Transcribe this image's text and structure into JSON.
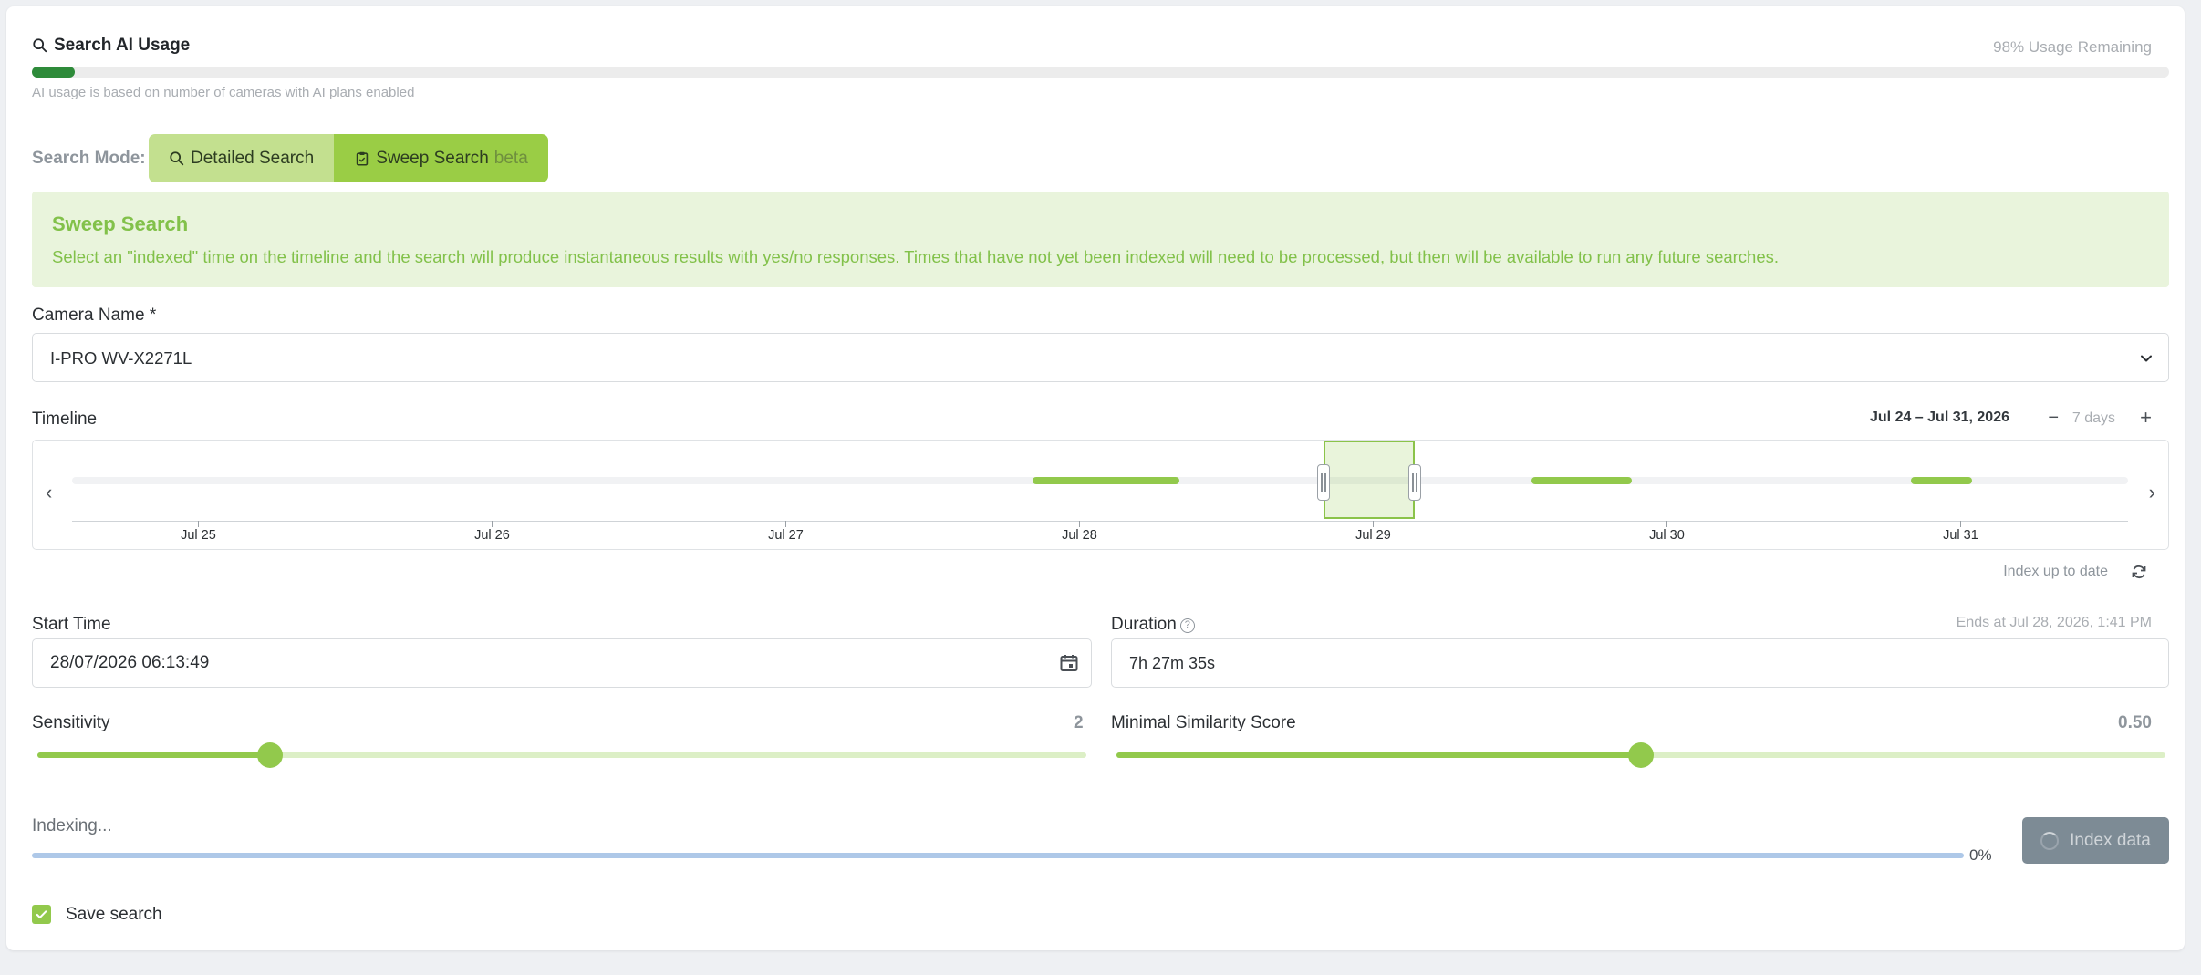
{
  "usage": {
    "title": "Search AI Usage",
    "remaining": "98% Usage Remaining",
    "used_fraction": 0.02,
    "note": "AI usage is based on number of cameras with AI plans enabled"
  },
  "search_mode": {
    "label": "Search Mode:",
    "detailed_label": "Detailed Search",
    "sweep_label": "Sweep Search",
    "sweep_badge": "beta",
    "active": "sweep"
  },
  "banner": {
    "title": "Sweep Search",
    "text": "Select an \"indexed\" time on the timeline and the search will produce instantaneous results with yes/no responses. Times that have not yet been indexed will need to be processed, but then will be available to run any future searches."
  },
  "camera": {
    "label": "Camera Name *",
    "value": "I-PRO WV-X2271L"
  },
  "timeline": {
    "label": "Timeline",
    "range": "Jul 24 – Jul 31, 2026",
    "zoom_minus": "−",
    "zoom_label": "7 days",
    "zoom_plus": "+",
    "prev": "‹",
    "next": "›",
    "ticks": [
      "Jul 25",
      "Jul 26",
      "Jul 27",
      "Jul 28",
      "Jul 29",
      "Jul 30",
      "Jul 31"
    ],
    "indexed_segments": [
      {
        "start_day": 3.27,
        "end_day": 3.77
      },
      {
        "start_day": 4.97,
        "end_day": 5.31
      },
      {
        "start_day": 6.26,
        "end_day": 6.47
      }
    ],
    "selection": {
      "start_day": 4.26,
      "end_day": 4.57
    },
    "index_status": "Index up to date"
  },
  "start_time": {
    "label": "Start Time",
    "value": "28/07/2026 06:13:49"
  },
  "duration": {
    "label": "Duration",
    "help": "?",
    "value": "7h 27m 35s",
    "ends_at": "Ends at Jul 28, 2026, 1:41 PM"
  },
  "sensitivity": {
    "label": "Sensitivity",
    "value": "2",
    "fraction": 0.222
  },
  "similarity": {
    "label": "Minimal Similarity Score",
    "value": "0.50",
    "fraction": 0.5
  },
  "indexing": {
    "label": "Indexing...",
    "percent": "0%",
    "progress": 0,
    "button_label": "Index data"
  },
  "save_search": {
    "label": "Save search",
    "checked": true
  },
  "colors": {
    "accent": "#92c94c",
    "sweep_active": "#9acd45",
    "detailed_inactive": "#c3e08f",
    "banner_bg": "#e9f4dc",
    "banner_text": "#82c14a",
    "usage_fill": "#2e8b3a",
    "index_button": "#7d8b95"
  }
}
